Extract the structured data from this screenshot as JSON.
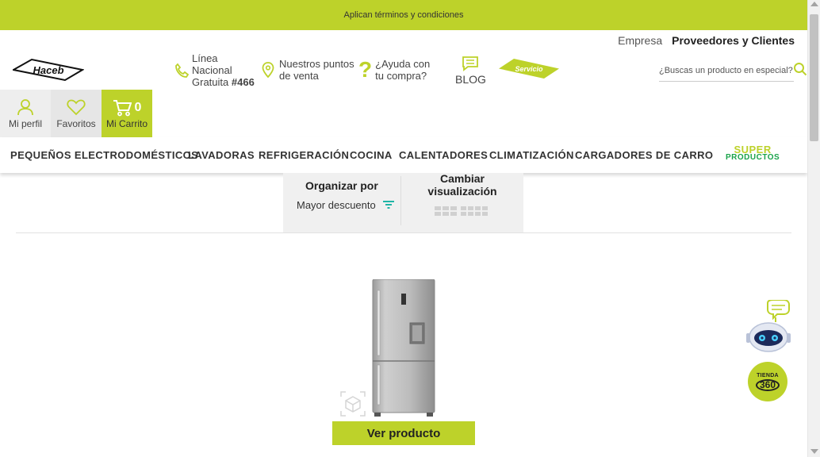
{
  "promo": {
    "text": "Aplican términos y condiciones"
  },
  "top_links": {
    "empresa": "Empresa",
    "proveedores": "Proveedores y Clientes"
  },
  "logo": {
    "text": "Haceb"
  },
  "header": {
    "phone": {
      "line1": "Línea",
      "line2": "Nacional",
      "line3": "Gratuita",
      "number": "#466"
    },
    "stores": {
      "line1": "Nuestros puntos",
      "line2": "de venta"
    },
    "help": {
      "mark": "?",
      "line1": "¿Ayuda con",
      "line2": "tu compra?"
    },
    "blog": "BLOG",
    "service": "Servicio"
  },
  "search": {
    "placeholder": "¿Buscas un producto en especial?"
  },
  "account": {
    "profile": "Mi perfil",
    "favorites": "Favoritos",
    "cart": "Mi Carrito",
    "cart_count": "0"
  },
  "nav": {
    "items": [
      "PEQUEÑOS ELECTRODOMÉSTICOS",
      "LAVADORAS",
      "REFRIGERACIÓN",
      "COCINA",
      "CALENTADORES",
      "CLIMATIZACIÓN",
      "CARGADORES DE CARRO"
    ],
    "super_line1": "SUPER",
    "super_line2": "PRODUCTOS"
  },
  "sort": {
    "title": "Organizar por",
    "value": "Mayor descuento"
  },
  "view": {
    "title": "Cambiar visualización"
  },
  "product": {
    "button": "Ver producto"
  },
  "widgets": {
    "tienda_label": "TIENDA",
    "tienda_number": "360"
  },
  "colors": {
    "accent": "#bdd22a",
    "green_text": "#1aa34a"
  }
}
